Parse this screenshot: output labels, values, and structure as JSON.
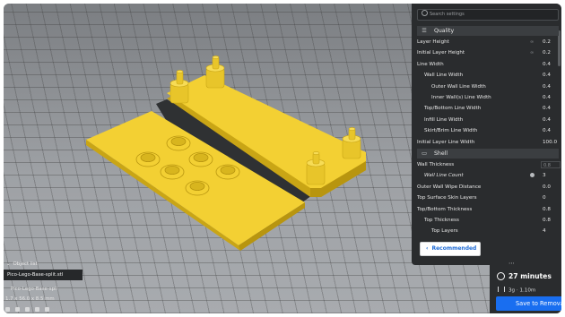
{
  "search": {
    "placeholder": "Search settings"
  },
  "sections": [
    {
      "title": "Quality",
      "icon": "quality-icon"
    },
    {
      "title": "Shell",
      "icon": "shell-icon"
    }
  ],
  "quality_rows": [
    {
      "label": "Layer Height",
      "value": "0.2",
      "linked": true
    },
    {
      "label": "Initial Layer Height",
      "value": "0.2",
      "linked": true
    },
    {
      "label": "Line Width",
      "value": "0.4"
    },
    {
      "label": "Wall Line Width",
      "value": "0.4"
    },
    {
      "label": "Outer Wall Line Width",
      "value": "0.4"
    },
    {
      "label": "Inner Wall(s) Line Width",
      "value": "0.4"
    },
    {
      "label": "Top/Bottom Line Width",
      "value": "0.4"
    },
    {
      "label": "Infill Line Width",
      "value": "0.4"
    },
    {
      "label": "Skirt/Brim Line Width",
      "value": "0.4"
    },
    {
      "label": "Initial Layer Line Width",
      "value": "100.0"
    }
  ],
  "shell_rows": [
    {
      "label": "Wall Thickness",
      "value": "0.8",
      "disabled": true
    },
    {
      "label": "Wall Line Count",
      "value": "3"
    },
    {
      "label": "Outer Wall Wipe Distance",
      "value": "0.0"
    },
    {
      "label": "Top Surface Skin Layers",
      "value": "0"
    },
    {
      "label": "Top/Bottom Thickness",
      "value": "0.8"
    },
    {
      "label": "Top Thickness",
      "value": "0.8"
    },
    {
      "label": "Top Layers",
      "value": "4"
    }
  ],
  "recommended_button": "Recommended",
  "estimate": {
    "time": "27 minutes",
    "material": "3g · 1.10m",
    "save_label": "Save to Removable"
  },
  "objects": {
    "toggle_label": "Object list",
    "selected": "Pico-Lego-Base-split.stl",
    "name": "Pico-Lego-Base-spli",
    "dims": "1.7 x 56.0 x 8.5 mm"
  },
  "colors": {
    "model": "#f3d033",
    "panel": "#2a2c2e",
    "accent": "#196ef0"
  }
}
